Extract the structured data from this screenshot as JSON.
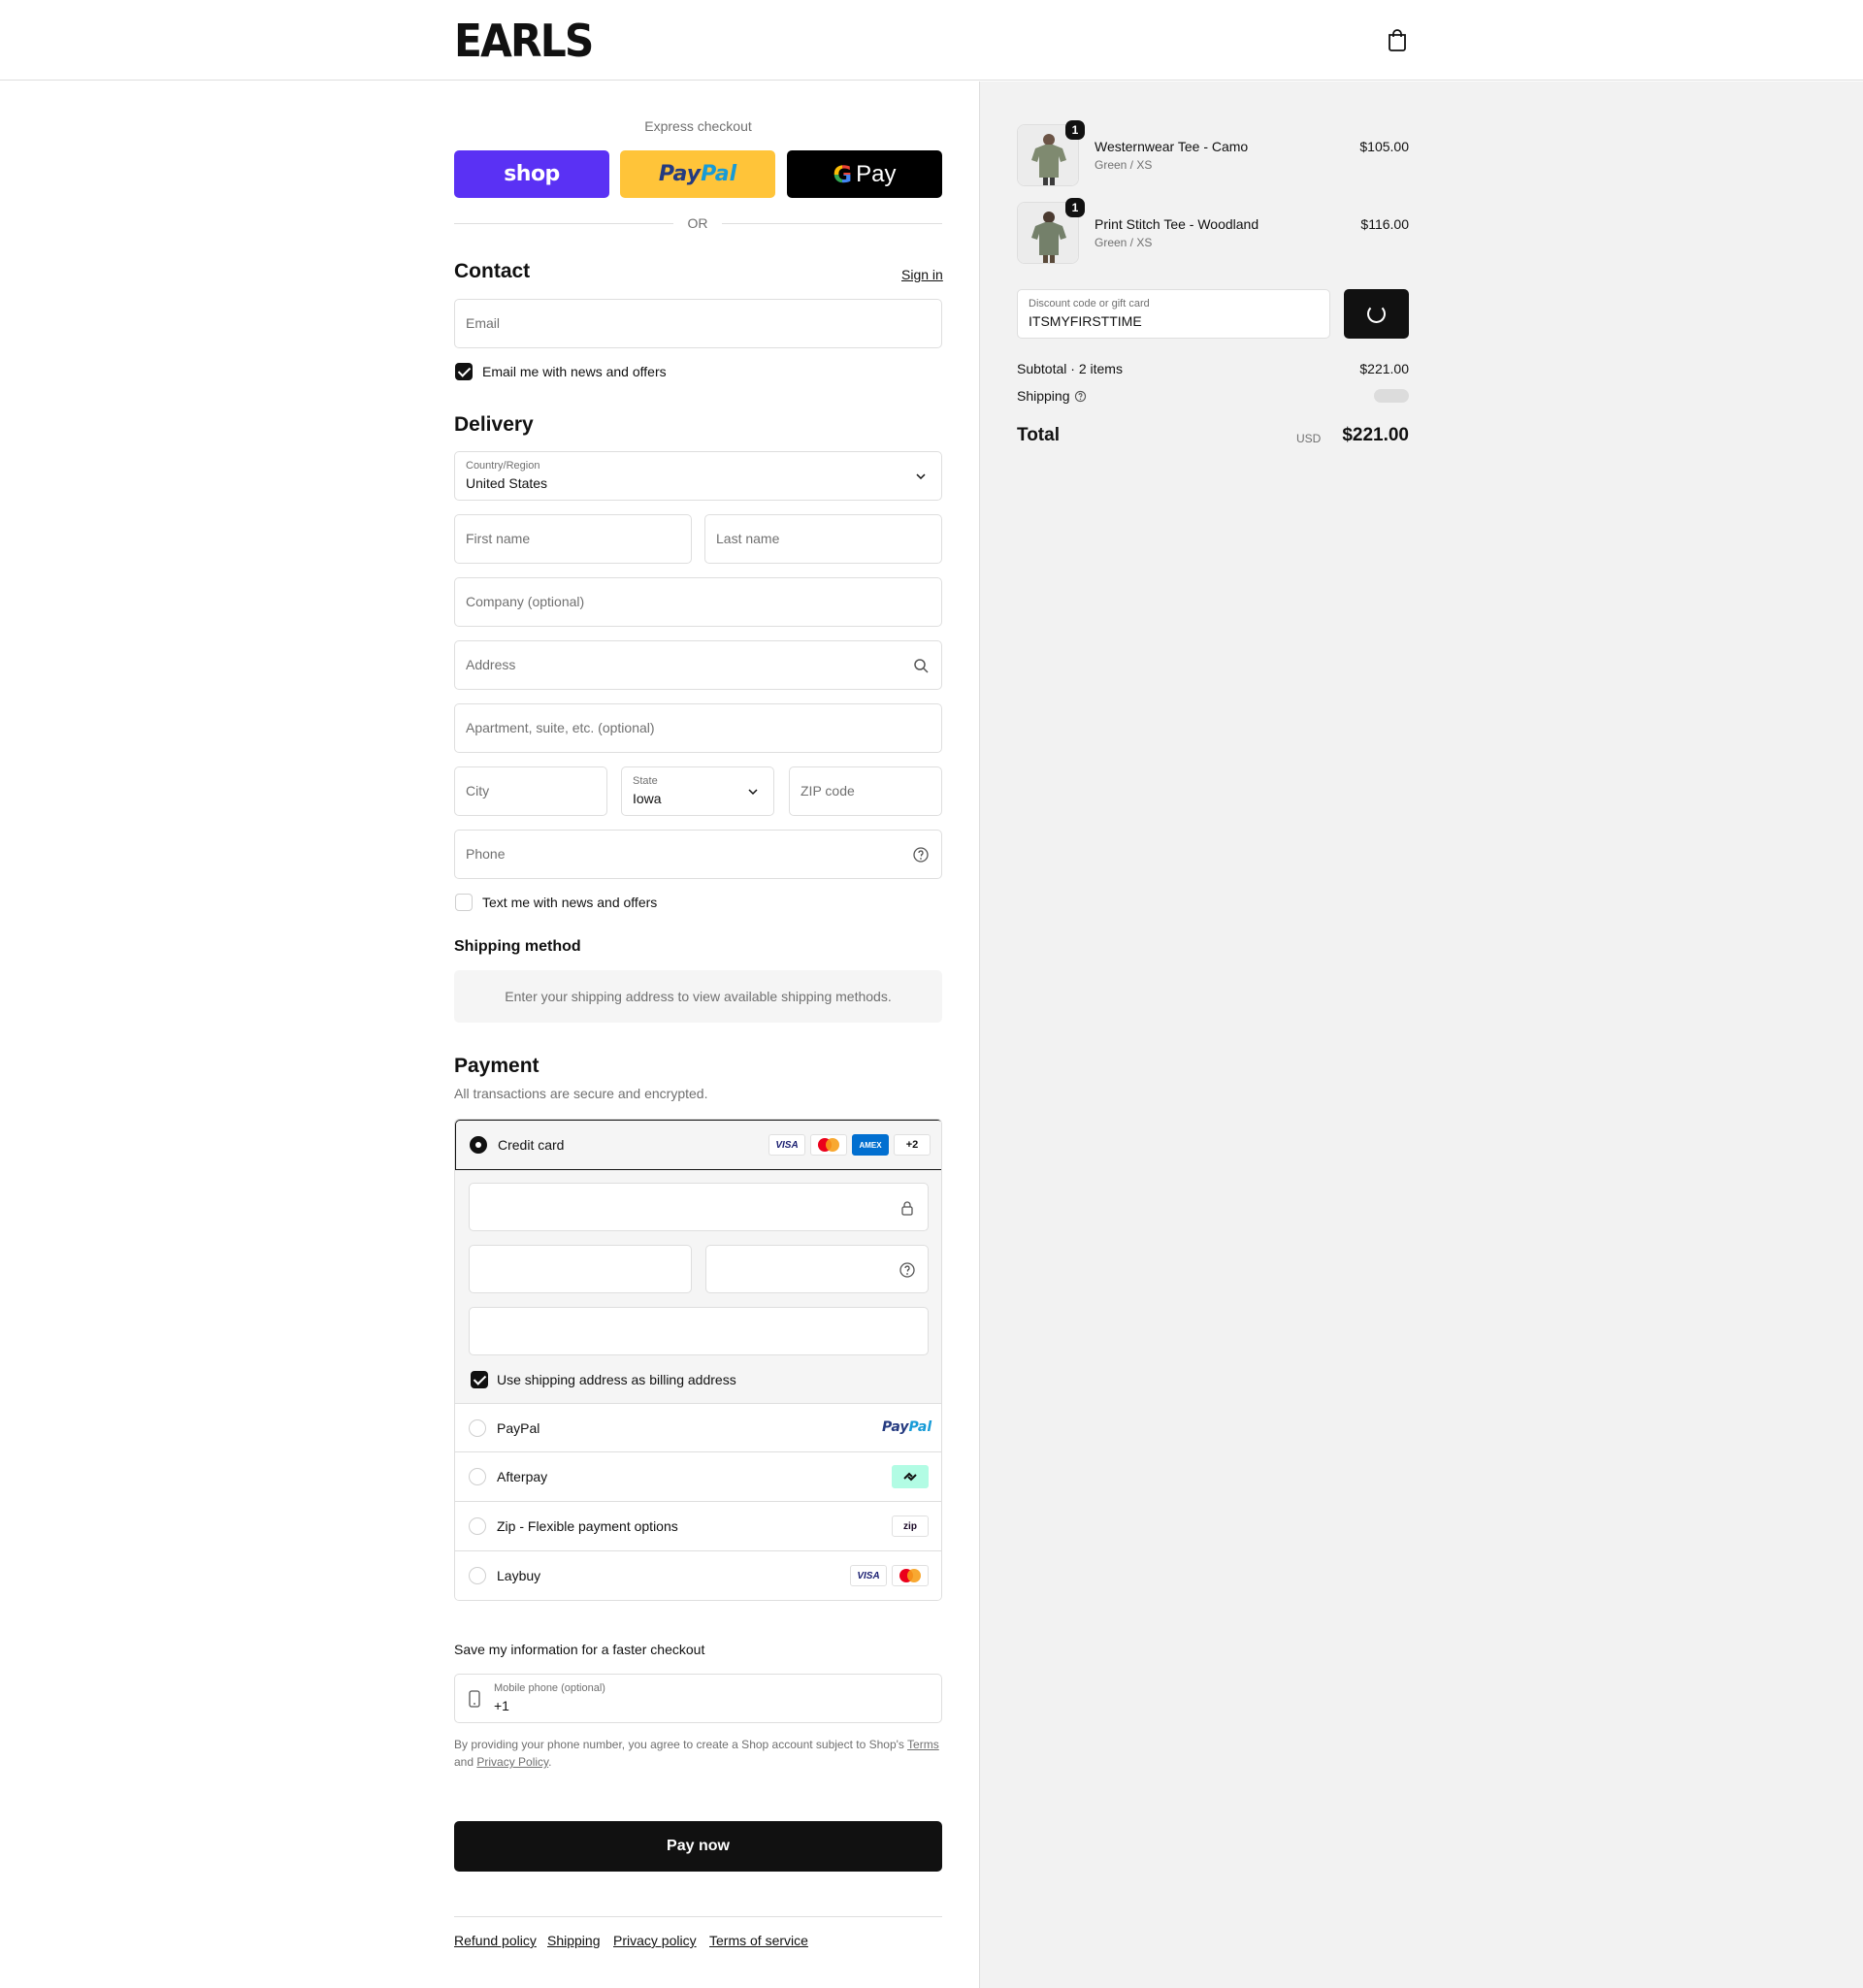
{
  "header": {
    "logo": "EARLS"
  },
  "express": {
    "title": "Express checkout",
    "shop_label": "shop",
    "paypal_a": "Pay",
    "paypal_b": "Pal",
    "gpay_g": "G",
    "gpay_label": "Pay",
    "or": "OR"
  },
  "contact": {
    "title": "Contact",
    "sign_in": "Sign in",
    "email_placeholder": "Email",
    "news_label": "Email me with news and offers",
    "news_checked": true
  },
  "delivery": {
    "title": "Delivery",
    "country_label": "Country/Region",
    "country_value": "United States",
    "first_name": "First name",
    "last_name": "Last name",
    "company": "Company (optional)",
    "address": "Address",
    "apartment": "Apartment, suite, etc. (optional)",
    "city": "City",
    "state_label": "State",
    "state_value": "Iowa",
    "zip": "ZIP code",
    "phone": "Phone",
    "text_label": "Text me with news and offers",
    "text_checked": false
  },
  "shipping_method": {
    "title": "Shipping method",
    "message": "Enter your shipping address to view available shipping methods."
  },
  "payment": {
    "title": "Payment",
    "subtitle": "All transactions are secure and encrypted.",
    "credit_card": "Credit card",
    "cards": {
      "visa": "VISA",
      "amex": "AMEX",
      "more": "+2"
    },
    "billing_label": "Use shipping address as billing address",
    "billing_checked": true,
    "options": [
      {
        "label": "PayPal",
        "logo_a": "Pay",
        "logo_b": "Pal"
      },
      {
        "label": "Afterpay"
      },
      {
        "label": "Zip - Flexible payment options",
        "logo": "zip"
      },
      {
        "label": "Laybuy",
        "logo": "VISA"
      }
    ]
  },
  "save_info": {
    "title": "Save my information for a faster checkout",
    "phone_label": "Mobile phone (optional)",
    "phone_value": "+1",
    "note_a": "By providing your phone number, you agree to create a Shop account subject to Shop's ",
    "terms": "Terms",
    "note_b": "and ",
    "privacy": "Privacy Policy",
    "note_c": "."
  },
  "pay_now": "Pay now",
  "footer": [
    "Refund policy",
    "Shipping",
    "Privacy policy",
    "Terms of service"
  ],
  "summary": {
    "items": [
      {
        "name": "Westernwear Tee - Camo",
        "variant": "Green / XS",
        "price": "$105.00",
        "qty": "1"
      },
      {
        "name": "Print Stitch Tee - Woodland",
        "variant": "Green / XS",
        "price": "$116.00",
        "qty": "1"
      }
    ],
    "discount_label": "Discount code or gift card",
    "discount_value": "ITSMYFIRSTTIME",
    "subtotal_label": "Subtotal · 2 items",
    "subtotal_value": "$221.00",
    "shipping_label": "Shipping",
    "total_label": "Total",
    "currency": "USD",
    "total_value": "$221.00"
  },
  "colors": {
    "accent": "#111111",
    "shop": "#5a31f4",
    "paypal": "#ffc439",
    "gpay": "#000000",
    "summary_bg": "#f2f2f2"
  }
}
